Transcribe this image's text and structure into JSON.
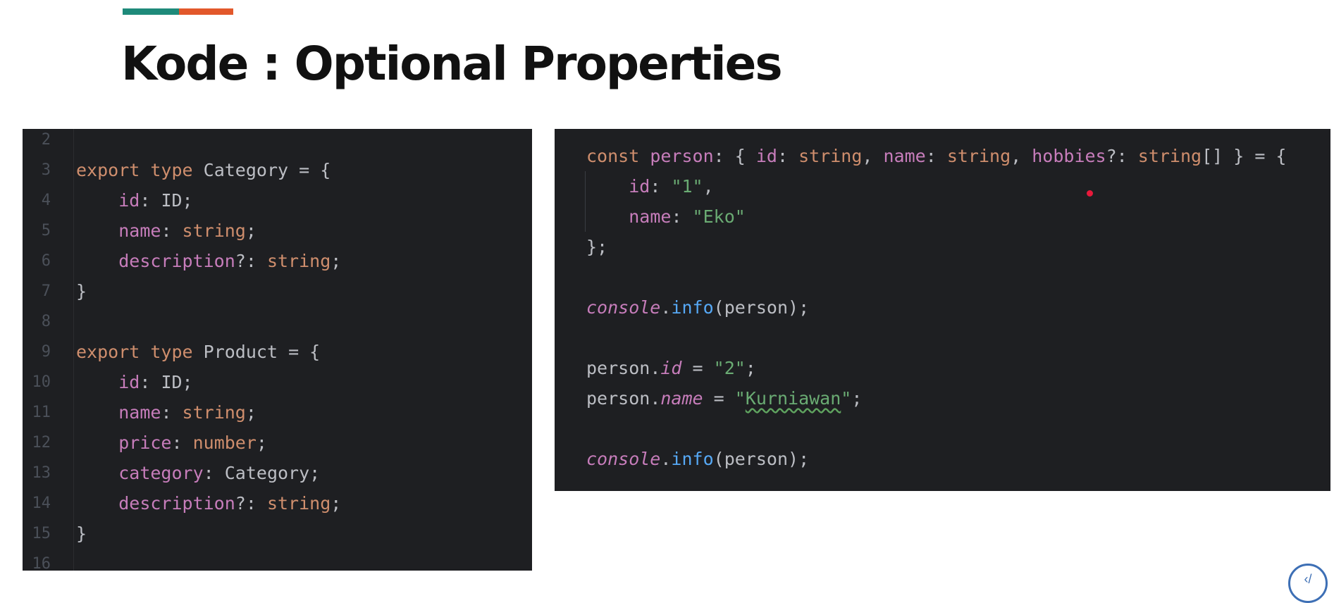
{
  "slide": {
    "title": "Kode : Optional Properties",
    "colors": {
      "accent_teal": "#1e8a7a",
      "accent_orange": "#e2582b",
      "editor_bg": "#1e1f22"
    }
  },
  "left_code": {
    "lines": [
      {
        "num": "2",
        "text": ""
      },
      {
        "num": "3",
        "text": "export type Category = {"
      },
      {
        "num": "4",
        "text": "    id: ID;"
      },
      {
        "num": "5",
        "text": "    name: string;"
      },
      {
        "num": "6",
        "text": "    description?: string;"
      },
      {
        "num": "7",
        "text": "}"
      },
      {
        "num": "8",
        "text": ""
      },
      {
        "num": "9",
        "text": "export type Product = {"
      },
      {
        "num": "10",
        "text": "    id: ID;"
      },
      {
        "num": "11",
        "text": "    name: string;"
      },
      {
        "num": "12",
        "text": "    price: number;"
      },
      {
        "num": "13",
        "text": "    category: Category;"
      },
      {
        "num": "14",
        "text": "    description?: string;"
      },
      {
        "num": "15",
        "text": "}"
      },
      {
        "num": "16",
        "text": ""
      }
    ]
  },
  "right_code": {
    "lines": [
      {
        "text": "const person: { id: string, name: string, hobbies?: string[] } = {"
      },
      {
        "text": "    id: \"1\","
      },
      {
        "text": "    name: \"Eko\""
      },
      {
        "text": "};"
      },
      {
        "text": ""
      },
      {
        "text": "console.info(person);"
      },
      {
        "text": ""
      },
      {
        "text": "person.id = \"2\";"
      },
      {
        "text": "person.name = \"Kurniawan\";"
      },
      {
        "text": ""
      },
      {
        "text": "console.info(person);"
      }
    ]
  },
  "corner_logo": {
    "icon": "logo-icon",
    "glyph": "‹/"
  }
}
